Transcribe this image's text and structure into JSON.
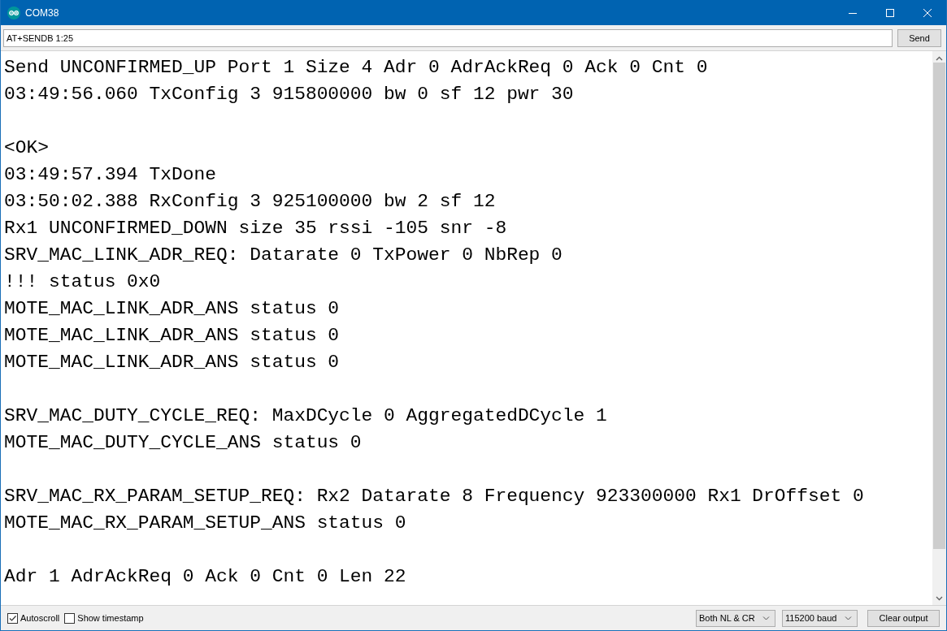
{
  "window": {
    "title": "COM38"
  },
  "send_field": {
    "value": "AT+SENDB 1:25"
  },
  "send_button": "Send",
  "output": {
    "blocks": [
      [
        "Send UNCONFIRMED_UP Port 1 Size 4 Adr 0 AdrAckReq 0 Ack 0 Cnt 0",
        "03:49:56.060 TxConfig 3 915800000 bw 0 sf 12 pwr 30"
      ],
      [
        "<OK>",
        "03:49:57.394 TxDone",
        "03:50:02.388 RxConfig 3 925100000 bw 2 sf 12",
        "Rx1 UNCONFIRMED_DOWN size 35 rssi -105 snr -8",
        "SRV_MAC_LINK_ADR_REQ: Datarate 0 TxPower 0 NbRep 0",
        "!!! status 0x0",
        "MOTE_MAC_LINK_ADR_ANS status 0",
        "MOTE_MAC_LINK_ADR_ANS status 0",
        "MOTE_MAC_LINK_ADR_ANS status 0"
      ],
      [
        "SRV_MAC_DUTY_CYCLE_REQ: MaxDCycle 0 AggregatedDCycle 1",
        "MOTE_MAC_DUTY_CYCLE_ANS status 0"
      ],
      [
        "SRV_MAC_RX_PARAM_SETUP_REQ: Rx2 Datarate 8 Frequency 923300000 Rx1 DrOffset 0",
        "MOTE_MAC_RX_PARAM_SETUP_ANS status 0"
      ],
      [
        "Adr 1 AdrAckReq 0 Ack 0 Cnt 0 Len 22"
      ]
    ]
  },
  "options": [
    {
      "label": "Autoscroll",
      "checked": true
    },
    {
      "label": "Show timestamp",
      "checked": false
    }
  ],
  "dropdowns": [
    {
      "value": "Both NL & CR"
    },
    {
      "value": "115200 baud"
    }
  ],
  "clear_button": "Clear output"
}
